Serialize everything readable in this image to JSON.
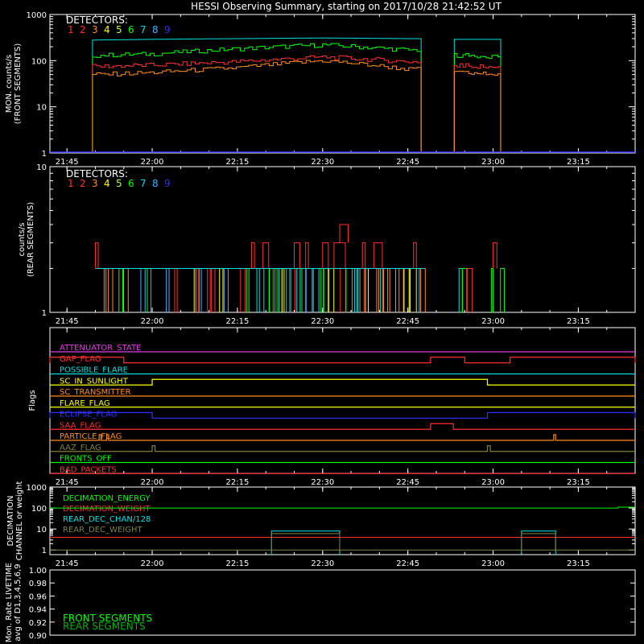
{
  "title": "HESSI Observing Summary, starting on 2017/10/28 21:42:52 UT",
  "time_axis": {
    "start": "21:42",
    "end": "23:25",
    "tick_labels": [
      "21:45",
      "22:00",
      "22:15",
      "22:30",
      "22:45",
      "23:00",
      "23:15"
    ]
  },
  "detector_colors": [
    "#ff3030",
    "#ff3030",
    "#ff8c1a",
    "#ffff00",
    "#b0ff30",
    "#00ff00",
    "#00e0e0",
    "#40b0ff",
    "#3030ff"
  ],
  "chart_data": [
    {
      "type": "line",
      "panel": "front",
      "ylabel": [
        "MON. counts/s",
        "(FRONT SEGMENTS)"
      ],
      "yscale": "log",
      "ylim": [
        1,
        1000
      ],
      "ytick_labels": [
        "1",
        "10",
        "100",
        "1000"
      ],
      "legend_title": "DETECTORS:",
      "legend_labels": [
        "1",
        "2",
        "3",
        "4",
        "5",
        "6",
        "7",
        "8",
        "9"
      ],
      "segments": [
        [
          "21:49:30",
          "22:47:20"
        ],
        [
          "22:53:10",
          "23:01:20"
        ]
      ],
      "series": [
        {
          "color": "#00e0e0",
          "x": [
            "21:50",
            "22:00",
            "22:15",
            "22:30",
            "22:45"
          ],
          "y": [
            280,
            290,
            300,
            310,
            300
          ],
          "x2": [
            "22:53",
            "23:01"
          ],
          "y2": [
            290,
            290
          ]
        },
        {
          "color": "#00ff00",
          "x": [
            "21:50",
            "22:00",
            "22:15",
            "22:30",
            "22:45"
          ],
          "y": [
            130,
            140,
            180,
            220,
            170
          ],
          "x2": [
            "22:53",
            "23:01"
          ],
          "y2": [
            130,
            125
          ]
        },
        {
          "color": "#ff3030",
          "x": [
            "21:50",
            "22:00",
            "22:15",
            "22:30",
            "22:45"
          ],
          "y": [
            75,
            80,
            95,
            120,
            95
          ],
          "x2": [
            "22:53",
            "23:01"
          ],
          "y2": [
            80,
            70
          ]
        },
        {
          "color": "#ff8c1a",
          "x": [
            "21:50",
            "22:00",
            "22:15",
            "22:30",
            "22:45"
          ],
          "y": [
            50,
            55,
            70,
            100,
            65
          ],
          "x2": [
            "22:53",
            "23:01"
          ],
          "y2": [
            55,
            50
          ]
        }
      ]
    },
    {
      "type": "line",
      "panel": "rear",
      "ylabel": [
        "counts/s",
        "(REAR SEGMENTS)"
      ],
      "yscale": "log",
      "ylim": [
        1,
        10
      ],
      "ytick_labels": [
        "1",
        "10"
      ],
      "legend_title": "DETECTORS:",
      "legend_labels": [
        "1",
        "2",
        "3",
        "4",
        "5",
        "6",
        "7",
        "8",
        "9"
      ],
      "baseline_level": 2,
      "peak_level": 3,
      "max_level": 4,
      "peaks": [
        [
          "21:50:00",
          "21:50:30"
        ],
        [
          "22:17:30",
          "22:18:00"
        ],
        [
          "22:19:30",
          "22:20:30"
        ],
        [
          "22:25:00",
          "22:26:00"
        ],
        [
          "22:27:00",
          "22:27:30"
        ],
        [
          "22:30:00",
          "22:31:00"
        ],
        [
          "22:32:00",
          "22:34:00"
        ],
        [
          "22:37:00",
          "22:37:30"
        ],
        [
          "22:39:00",
          "22:40:30"
        ],
        [
          "22:46:00",
          "22:46:30"
        ],
        [
          "23:00:00",
          "23:00:40"
        ]
      ],
      "max_peaks": [
        [
          "22:33:00",
          "22:34:30"
        ]
      ],
      "active": [
        [
          "21:50:00",
          "21:56:30"
        ],
        [
          "21:58:00",
          "22:48:00"
        ],
        [
          "22:54:00",
          "23:01:30"
        ]
      ]
    },
    {
      "type": "table",
      "panel": "flags",
      "ylabel": "Flags",
      "flags": [
        {
          "name": "ATTENUATOR_STATE",
          "color": "#e040e0",
          "high": []
        },
        {
          "name": "GAP_FLAG",
          "color": "#ff3030",
          "high": [
            [
              "21:42",
              "21:55"
            ],
            [
              "22:49",
              "22:55"
            ],
            [
              "23:03",
              "23:25"
            ]
          ]
        },
        {
          "name": "POSSIBLE_FLARE",
          "color": "#00e0e0",
          "high": []
        },
        {
          "name": "SC_IN_SUNLIGHT",
          "color": "#ffff00",
          "high": [
            [
              "22:00",
              "22:59"
            ]
          ]
        },
        {
          "name": "SC_TRANSMITTER",
          "color": "#ff8c1a",
          "high": []
        },
        {
          "name": "FLARE_FLAG",
          "color": "#ffff00",
          "high": []
        },
        {
          "name": "ECLIPSE_FLAG",
          "color": "#3030ff",
          "high": [
            [
              "21:42",
              "22:00"
            ],
            [
              "22:59",
              "23:25"
            ]
          ]
        },
        {
          "name": "SAA_FLAG",
          "color": "#ff3030",
          "high": [
            [
              "22:49",
              "22:53"
            ]
          ]
        },
        {
          "name": "PARTICLE_FLAG",
          "color": "#ff8c1a",
          "high": [
            [
              "21:50:40",
              "21:51:00"
            ],
            [
              "21:52:00",
              "21:52:20"
            ],
            [
              "23:10:40",
              "23:11:00"
            ]
          ]
        },
        {
          "name": "AAZ_FLAG",
          "color": "#808040",
          "high": [
            [
              "22:00",
              "22:00:30"
            ],
            [
              "22:59",
              "22:59:30"
            ]
          ]
        },
        {
          "name": "FRONTS_OFF",
          "color": "#00ff00",
          "high": []
        },
        {
          "name": "BAD_PACKETS",
          "color": "#ff3030",
          "high": []
        }
      ]
    },
    {
      "type": "line",
      "panel": "decimation",
      "ylabel": [
        "DECIMATION",
        "CHANNEL or weight"
      ],
      "yscale": "log",
      "ylim": [
        0.6,
        1000
      ],
      "ytick_labels": [
        "1",
        "10",
        "100",
        "1000"
      ],
      "legend": [
        {
          "label": "DECIMATION_ENERGY",
          "color": "#00ff00"
        },
        {
          "label": "DECIMATION_WEIGHT",
          "color": "#ff3030"
        },
        {
          "label": "REAR_DEC_CHAN/128",
          "color": "#00e0e0"
        },
        {
          "label": "REAR_DEC_WEIGHT",
          "color": "#808040"
        }
      ],
      "series": [
        {
          "name": "DECIMATION_ENERGY",
          "color": "#00ff00",
          "x": [
            "21:42",
            "23:22",
            "23:22",
            "23:25"
          ],
          "y": [
            100,
            100,
            110,
            110
          ]
        },
        {
          "name": "DECIMATION_WEIGHT",
          "color": "#ff3030",
          "x": [
            "21:42",
            "23:25"
          ],
          "y": [
            4,
            4
          ]
        },
        {
          "name": "REAR_DEC_CHAN/128",
          "color": "#00e0e0",
          "boxes": [
            [
              "22:21",
              "22:33",
              8
            ],
            [
              "23:05",
              "23:11",
              8
            ]
          ],
          "base": 0.6
        },
        {
          "name": "REAR_DEC_WEIGHT",
          "color": "#808040",
          "baseline": 1,
          "boxes": [
            [
              "22:21",
              "22:33",
              6
            ],
            [
              "23:05",
              "23:11",
              6
            ]
          ]
        }
      ]
    },
    {
      "type": "line",
      "panel": "livetime",
      "ylabel": [
        "Mon. Rate LIVETIME",
        "avg of D1,3,4,5,6,9"
      ],
      "ylim": [
        0.9,
        1.0
      ],
      "ytick_labels": [
        "0.90",
        "0.92",
        "0.94",
        "0.96",
        "0.98",
        "1.00"
      ],
      "legend": [
        {
          "label": "FRONT SEGMENTS",
          "color": "#00ff00"
        },
        {
          "label": "REAR SEGMENTS",
          "color": "#00b000"
        }
      ]
    }
  ]
}
